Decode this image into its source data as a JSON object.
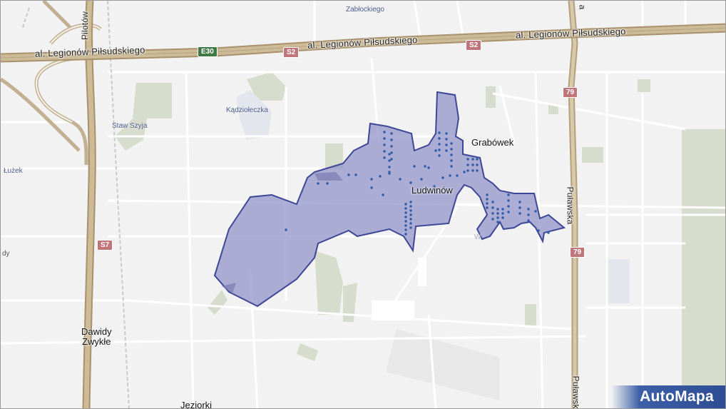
{
  "map": {
    "roads": {
      "main_road_left": "al. Legionów Piłsudskiego",
      "main_road_right": "al. Legionów Piłsudskiego",
      "pilotow": "Pilotów",
      "pulawska_top": "Puławska",
      "pulawska_bottom": "Puławska"
    },
    "shields": {
      "e30": "E30",
      "s2_left": "S2",
      "s2_right": "S2",
      "s7": "S7",
      "r79_top": "79",
      "r79_bottom": "79"
    },
    "places": {
      "ludwinow": "Ludwinów",
      "grabowek": "Grabówek",
      "dawidy_line1": "Dawidy",
      "dawidy_line2": "Zwykłe",
      "jeziorki": "Jeziorki",
      "zablockiego": "Zabłockiego",
      "kadziołeczka": "Kądziołeczka",
      "staw_szyja": "Staw Szyja",
      "luzek": "Łużek",
      "edge_label": "dy",
      "top_right_edge": "a",
      "small_near_region": "W"
    },
    "region_color": "#8e90c8",
    "region_stroke": "#3e4797",
    "dot_color": "#2f5aa8"
  },
  "brand": {
    "logo": "AutoMapa"
  }
}
